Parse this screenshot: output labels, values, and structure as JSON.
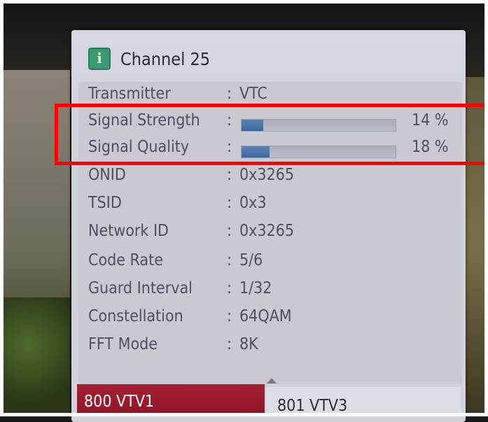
{
  "header": {
    "title": "Channel 25",
    "icon": "info-icon"
  },
  "rows": [
    {
      "label": "Transmitter",
      "colon": ":",
      "value": "VTC"
    },
    {
      "label": "Signal Strength",
      "colon": ":",
      "percent": "14 %",
      "level": 0.14
    },
    {
      "label": "Signal Quality",
      "colon": ":",
      "percent": "18 %",
      "level": 0.18
    },
    {
      "label": "ONID",
      "colon": ":",
      "value": "0x3265"
    },
    {
      "label": "TSID",
      "colon": ":",
      "value": "0x3"
    },
    {
      "label": "Network ID",
      "colon": ":",
      "value": "0x3265"
    },
    {
      "label": "Code Rate",
      "colon": ":",
      "value": "5/6"
    },
    {
      "label": "Guard Interval",
      "colon": ":",
      "value": "1/32"
    },
    {
      "label": "Constellation",
      "colon": ":",
      "value": "64QAM"
    },
    {
      "label": "FFT Mode",
      "colon": ":",
      "value": "8K"
    }
  ],
  "channels": [
    {
      "label": "800  VTV1",
      "selected": true
    },
    {
      "label": "801  VTV3",
      "selected": false
    }
  ],
  "colors": {
    "highlight": "#ff0000",
    "selected_channel": "#9b1a2e",
    "bar_fill": "#4a73ae"
  }
}
